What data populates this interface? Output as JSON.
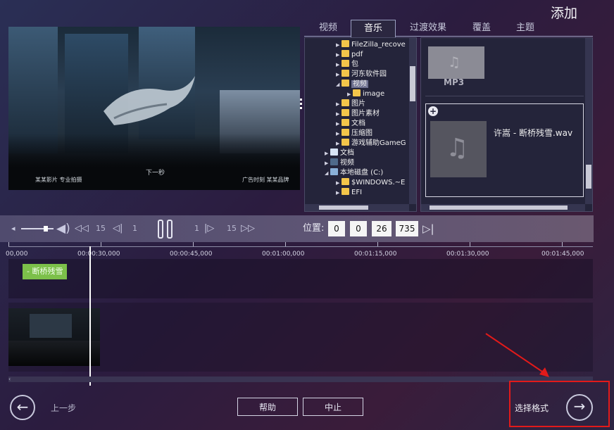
{
  "header": {
    "add_title": "添加"
  },
  "tabs": [
    {
      "label": "视频",
      "active": false
    },
    {
      "label": "音乐",
      "active": true
    },
    {
      "label": "过渡效果",
      "active": false
    },
    {
      "label": "覆盖",
      "active": false
    },
    {
      "label": "主题",
      "active": false
    }
  ],
  "preview": {
    "subtitle_center": "下一秒",
    "subtitle_left": "某某影片 专业拍摄",
    "subtitle_right": "广告时刻 某某品牌"
  },
  "tree": {
    "nodes": [
      {
        "label": "FileZilla_recove",
        "icon": "folder-icon",
        "arrow": "▶"
      },
      {
        "label": "pdf",
        "icon": "folder-icon",
        "arrow": "▶"
      },
      {
        "label": "包",
        "icon": "folder-icon",
        "arrow": "▶"
      },
      {
        "label": "河东软件园",
        "icon": "folder-icon",
        "arrow": "▶"
      },
      {
        "label": "视频",
        "icon": "folder-icon",
        "arrow": "◢",
        "selected": true
      },
      {
        "label": "image",
        "icon": "folder-icon",
        "arrow": "▶",
        "sub": true
      },
      {
        "label": "图片",
        "icon": "folder-icon",
        "arrow": "▶"
      },
      {
        "label": "图片素材",
        "icon": "folder-icon",
        "arrow": "▶"
      },
      {
        "label": "文档",
        "icon": "folder-icon",
        "arrow": "▶"
      },
      {
        "label": "压缩图",
        "icon": "folder-icon",
        "arrow": "▶"
      },
      {
        "label": "游戏辅助GameG",
        "icon": "folder-icon",
        "arrow": "▶"
      },
      {
        "label": "文档",
        "icon": "document-icon",
        "arrow": "▶",
        "top": true
      },
      {
        "label": "视频",
        "icon": "video-icon",
        "arrow": "▶",
        "top": true
      },
      {
        "label": "本地磁盘 (C:)",
        "icon": "drive-icon",
        "arrow": "◢",
        "top": true
      },
      {
        "label": "$WINDOWS.~E",
        "icon": "folder-icon",
        "arrow": "▶"
      },
      {
        "label": "EFI",
        "icon": "folder-icon",
        "arrow": "▶"
      }
    ]
  },
  "files": {
    "items": [
      {
        "name": "MP3",
        "icon": "music-file-icon"
      },
      {
        "name": "许嵩 - 断桥残雪.wav",
        "icon": "music-file-icon"
      }
    ]
  },
  "transport": {
    "skip_back_label": "15",
    "frame_back_label": "1",
    "frame_fwd_label": "1",
    "skip_fwd_label": "15",
    "position_label": "位置:",
    "position_h": "0",
    "position_m": "0",
    "position_s": "26",
    "position_ms": "735",
    "volume_level": 0.75
  },
  "timeline": {
    "ticks": [
      "00:00:30,000",
      "00:00:45,000",
      "00:01:00,000",
      "00:01:15,000",
      "00:01:30,000",
      "00:01:45,000"
    ],
    "first_tick_partial": "00,000",
    "audio_clip_label": "- 断桥残雪"
  },
  "footer": {
    "back_label": "上一步",
    "help_label": "帮助",
    "stop_label": "中止",
    "next_label": "选择格式"
  },
  "colors": {
    "accent_red": "#e21a1a",
    "audio_clip": "#7cc04a"
  }
}
